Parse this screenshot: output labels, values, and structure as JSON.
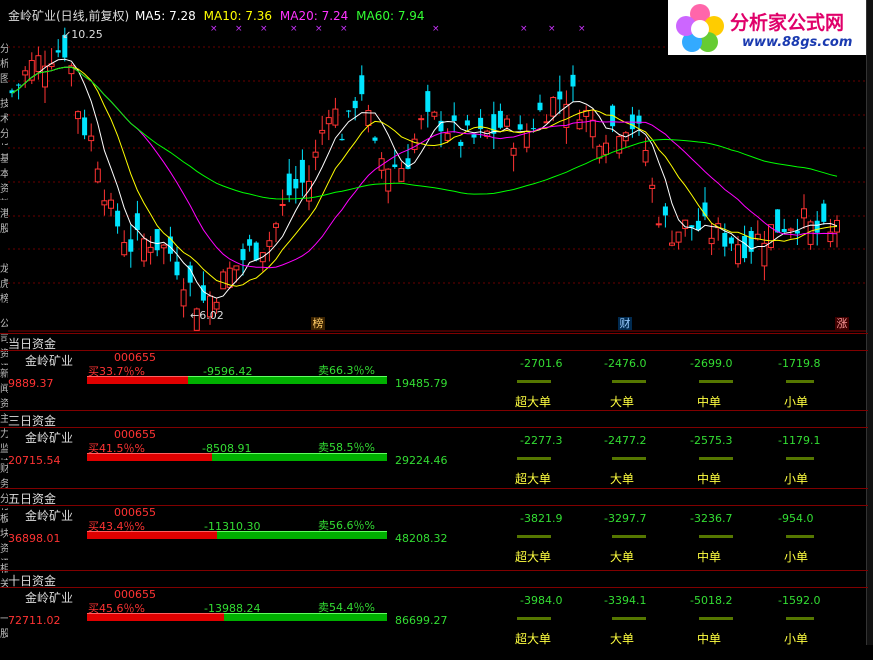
{
  "header": {
    "title": "金岭矿业(日线,前复权)",
    "ma5": "MA5: 7.28",
    "ma10": "MA10: 7.36",
    "ma20": "MA20: 7.24",
    "ma60": "MA60: 7.94"
  },
  "chart": {
    "high_label": "10.25",
    "low_label": "6.02",
    "event_tags": [
      "榜",
      "财",
      "涨"
    ]
  },
  "logo": {
    "brand": "分析家公式网",
    "url": "www.88gs.com"
  },
  "sidebar_tabs": [
    "分析图",
    "技术分析",
    "基本资料",
    "港股",
    "龙虎榜",
    "公司资讯",
    "新闻资讯",
    "主力监控",
    "财务分析",
    "板块资讯",
    "相关",
    "一股"
  ],
  "sections": [
    {
      "title": "当日资金",
      "stock": "金岭矿业",
      "code": "000655",
      "buy_pct": "买33.7％%",
      "net": "-9596.42",
      "sell_pct": "卖66.3％%",
      "left_amount": "9889.37",
      "right_amount": "19485.79",
      "buy_ratio": 0.337,
      "flows": [
        "-2701.6",
        "-2476.0",
        "-2699.0",
        "-1719.8"
      ],
      "labels": [
        "超大单",
        "大单",
        "中单",
        "小单"
      ]
    },
    {
      "title": "三日资金",
      "stock": "金岭矿业",
      "code": "000655",
      "buy_pct": "买41.5％%",
      "net": "-8508.91",
      "sell_pct": "卖58.5％%",
      "left_amount": "20715.54",
      "right_amount": "29224.46",
      "buy_ratio": 0.415,
      "flows": [
        "-2277.3",
        "-2477.2",
        "-2575.3",
        "-1179.1"
      ],
      "labels": [
        "超大单",
        "大单",
        "中单",
        "小单"
      ]
    },
    {
      "title": "五日资金",
      "stock": "金岭矿业",
      "code": "000655",
      "buy_pct": "买43.4％%",
      "net": "-11310.30",
      "sell_pct": "卖56.6％%",
      "left_amount": "36898.01",
      "right_amount": "48208.32",
      "buy_ratio": 0.434,
      "flows": [
        "-3821.9",
        "-3297.7",
        "-3236.7",
        "-954.0"
      ],
      "labels": [
        "超大单",
        "大单",
        "中单",
        "小单"
      ]
    },
    {
      "title": "十日资金",
      "stock": "金岭矿业",
      "code": "000655",
      "buy_pct": "买45.6％%",
      "net": "-13988.24",
      "sell_pct": "卖54.4％%",
      "left_amount": "72711.02",
      "right_amount": "86699.27",
      "buy_ratio": 0.456,
      "flows": [
        "-3984.0",
        "-3394.1",
        "-5018.2",
        "-1592.0"
      ],
      "labels": [
        "超大单",
        "大单",
        "中单",
        "小单"
      ]
    }
  ],
  "colors": {
    "up": "#ff3333",
    "down": "#00e5ff",
    "ma5": "#ffffff",
    "ma10": "#ffff00",
    "ma20": "#ff00ff",
    "ma60": "#00ff00",
    "grid": "#800000"
  }
}
